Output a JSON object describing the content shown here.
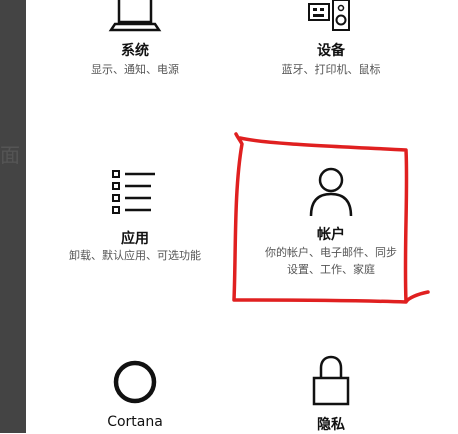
{
  "left_fragment": "面",
  "tiles": {
    "system": {
      "title": "系统",
      "desc": "显示、通知、电源"
    },
    "devices": {
      "title": "设备",
      "desc": "蓝牙、打印机、鼠标"
    },
    "apps": {
      "title": "应用",
      "desc": "卸载、默认应用、可选功能"
    },
    "accounts": {
      "title": "帐户",
      "desc_line1": "你的帐户、电子邮件、同步",
      "desc_line2": "设置、工作、家庭"
    },
    "cortana": {
      "title": "Cortana"
    },
    "privacy": {
      "title": "隐私"
    }
  },
  "icons": {
    "system": "laptop-icon",
    "devices": "keyboard-speaker-icon",
    "apps": "list-icon",
    "accounts": "person-icon",
    "cortana": "circle-icon",
    "privacy": "lock-icon"
  },
  "colors": {
    "annotation": "#e02020",
    "left_strip": "#444444"
  }
}
